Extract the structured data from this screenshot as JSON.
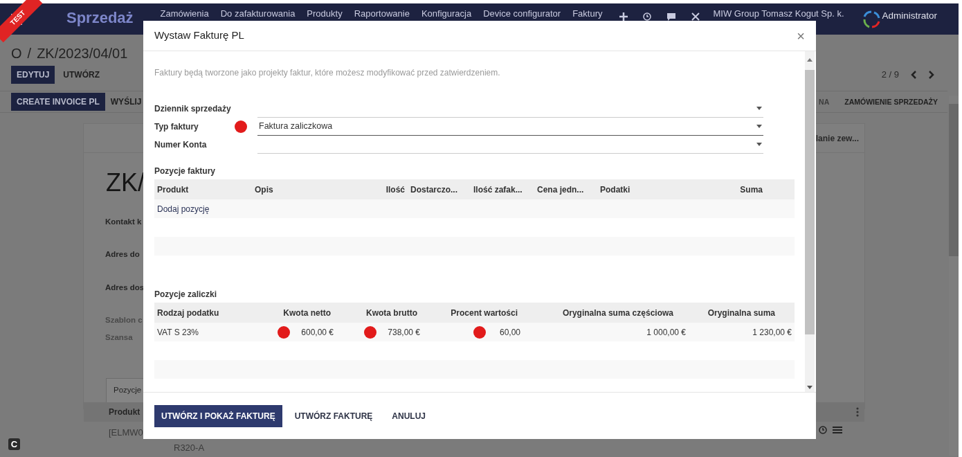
{
  "navbar": {
    "app_name": "Sprzedaż",
    "menu": [
      "Zamówienia",
      "Do zafakturowania",
      "Produkty",
      "Raportowanie",
      "Konfiguracja",
      "Device configurator",
      "Faktury"
    ],
    "company": "MIW Group Tomasz Kogut Sp. k.",
    "user": "Administrator"
  },
  "ribbon": "TEST",
  "breadcrumb": {
    "items": [
      "O",
      "ZK/2023/04/01"
    ],
    "separator": "/"
  },
  "control_buttons": [
    {
      "label": "EDYTUJ",
      "primary": true
    },
    {
      "label": "UTWÓRZ",
      "primary": false
    }
  ],
  "pager": "2 / 9",
  "status_actions": [
    {
      "label": "CREATE INVOICE PL",
      "primary": true
    },
    {
      "label": "WYŚLIJ",
      "primary": false
    }
  ],
  "status_stages": [
    {
      "label": "NA",
      "selected": false
    },
    {
      "label": "ZAMÓWIENIE SPRZEDAŻY",
      "selected": true
    }
  ],
  "sheet": {
    "smart_button": "lanie zew...",
    "title": "ZK/",
    "fields": [
      {
        "label": "Kontakt k",
        "muted": false
      },
      {
        "label": "Adres do",
        "muted": false
      },
      {
        "label": "Adres dos",
        "muted": false
      },
      {
        "label": "Szablon c",
        "muted": true
      },
      {
        "label": "Szansa",
        "muted": true
      }
    ],
    "tab": "Pozycje",
    "lines_header": "Produkt",
    "line": {
      "code": "[ELMW0",
      "variant": "R320-A"
    }
  },
  "corner_badge": "C",
  "modal": {
    "title": "Wystaw Fakturę PL",
    "close": "×",
    "intro": "Faktury będą tworzone jako projekty faktur, które możesz modyfikować przed zatwierdzeniem.",
    "fields": [
      {
        "label": "Dziennik sprzedaży",
        "marker": false,
        "focused": false
      },
      {
        "label": "Typ faktury",
        "value": "Faktura zaliczkowa",
        "marker": true,
        "focused": true
      },
      {
        "label": "Numer Konta",
        "marker": false,
        "focused": false
      }
    ],
    "invoice_lines": {
      "title": "Pozycje faktury",
      "columns": [
        "Produkt",
        "Opis",
        "Ilość",
        "Dostarczo...",
        "Ilość zafak...",
        "Cena jedn...",
        "Podatki",
        "Suma"
      ],
      "add_link": "Dodaj pozycję"
    },
    "advance_lines": {
      "title": "Pozycje zaliczki",
      "columns": [
        "Rodzaj podatku",
        "Kwota netto",
        "Kwota brutto",
        "Procent wartości",
        "Oryginalna suma częściowa",
        "Oryginalna suma"
      ],
      "rows": [
        {
          "cells": [
            {
              "text": "VAT S 23%",
              "marker": false
            },
            {
              "text": "600,00 €",
              "marker": true
            },
            {
              "text": "738,00 €",
              "marker": true
            },
            {
              "text": "60,00",
              "marker": true
            },
            {
              "text": "1 000,00 €",
              "marker": false
            },
            {
              "text": "1 230,00 €",
              "marker": false
            }
          ]
        }
      ]
    },
    "buttons": [
      {
        "label": "UTWÓRZ I POKAŻ FAKTURĘ",
        "primary": true
      },
      {
        "label": "UTWÓRZ FAKTURĘ",
        "primary": false
      },
      {
        "label": "ANULUJ",
        "primary": false
      }
    ]
  }
}
